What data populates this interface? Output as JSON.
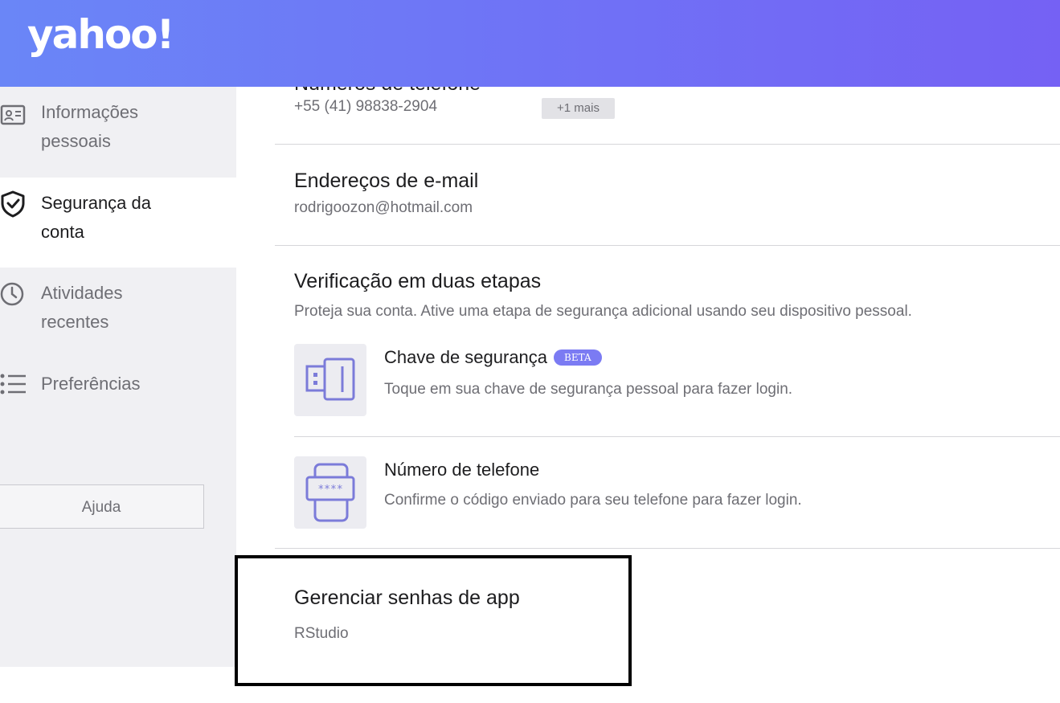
{
  "header": {
    "logo": "yahoo!"
  },
  "sidebar": {
    "items": [
      {
        "label_line1": "Informações",
        "label_line2": "pessoais",
        "icon": "id-card-icon"
      },
      {
        "label_line1": "Segurança da",
        "label_line2": "conta",
        "icon": "shield-check-icon",
        "active": true
      },
      {
        "label_line1": "Atividades",
        "label_line2": "recentes",
        "icon": "clock-icon"
      },
      {
        "label_line1": "Preferências",
        "label_line2": "",
        "icon": "list-icon"
      }
    ],
    "help_label": "Ajuda"
  },
  "main": {
    "phones": {
      "title": "Números de telefone",
      "value": "+55 (41) 98838-2904",
      "more": "+1 mais"
    },
    "emails": {
      "title": "Endereços de e-mail",
      "value": "rodrigoozon@hotmail.com"
    },
    "two_step": {
      "title": "Verificação em duas etapas",
      "subtitle": "Proteja sua conta. Ative uma etapa de segurança adicional usando seu dispositivo pessoal.",
      "methods": [
        {
          "title": "Chave de segurança",
          "badge": "BETA",
          "desc": "Toque em sua chave de segurança pessoal para fazer login.",
          "icon": "security-key-icon"
        },
        {
          "title": "Número de telefone",
          "desc": "Confirme o código enviado para seu telefone para fazer login.",
          "icon": "phone-code-icon"
        }
      ]
    },
    "app_passwords": {
      "title": "Gerenciar senhas de app",
      "item": "RStudio"
    }
  },
  "colors": {
    "header_start": "#6a86f7",
    "header_end": "#7561f4",
    "accent": "#7b7bf3",
    "icon_stroke": "#7b7bd9",
    "sidebar_bg": "#f0f0f3"
  }
}
